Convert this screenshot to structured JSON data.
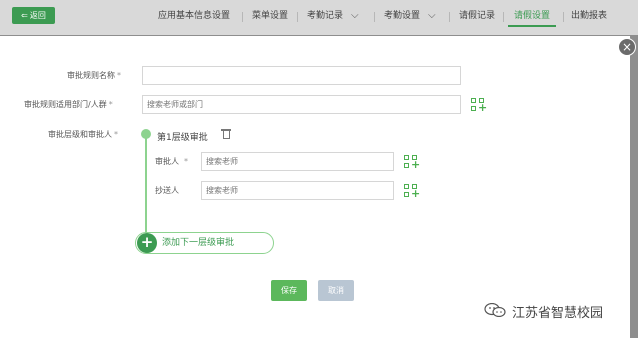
{
  "topbar": {
    "back_label": "返回",
    "tabs": [
      {
        "label": "应用基本信息设置",
        "active": false,
        "dropdown": false
      },
      {
        "label": "菜单设置",
        "active": false,
        "dropdown": false
      },
      {
        "label": "考勤记录",
        "active": false,
        "dropdown": true
      },
      {
        "label": "考勤设置",
        "active": false,
        "dropdown": true
      },
      {
        "label": "请假记录",
        "active": false,
        "dropdown": false
      },
      {
        "label": "请假设置",
        "active": true,
        "dropdown": false
      },
      {
        "label": "出勤报表",
        "active": false,
        "dropdown": false
      }
    ]
  },
  "form": {
    "rule_name": {
      "label": "审批规则名称",
      "required": "*",
      "value": "",
      "placeholder": ""
    },
    "scope": {
      "label": "审批规则适用部门/人群",
      "required": "*",
      "placeholder": "搜索老师或部门"
    },
    "levels_label": {
      "label": "审批层级和审批人",
      "required": "*"
    },
    "level": {
      "title": "第1层级审批",
      "approver": {
        "label": "审批人",
        "required": "*",
        "placeholder": "搜索老师"
      },
      "cc": {
        "label": "抄送人",
        "placeholder": "搜索老师"
      }
    },
    "add_level_label": "添加下一层级审批"
  },
  "actions": {
    "save_label": "保存",
    "cancel_label": "取消"
  },
  "watermark": "江苏省智慧校园",
  "colors": {
    "accent": "#3c9b52",
    "light_accent": "#8dd38f",
    "cancel": "#b9c6d3"
  }
}
